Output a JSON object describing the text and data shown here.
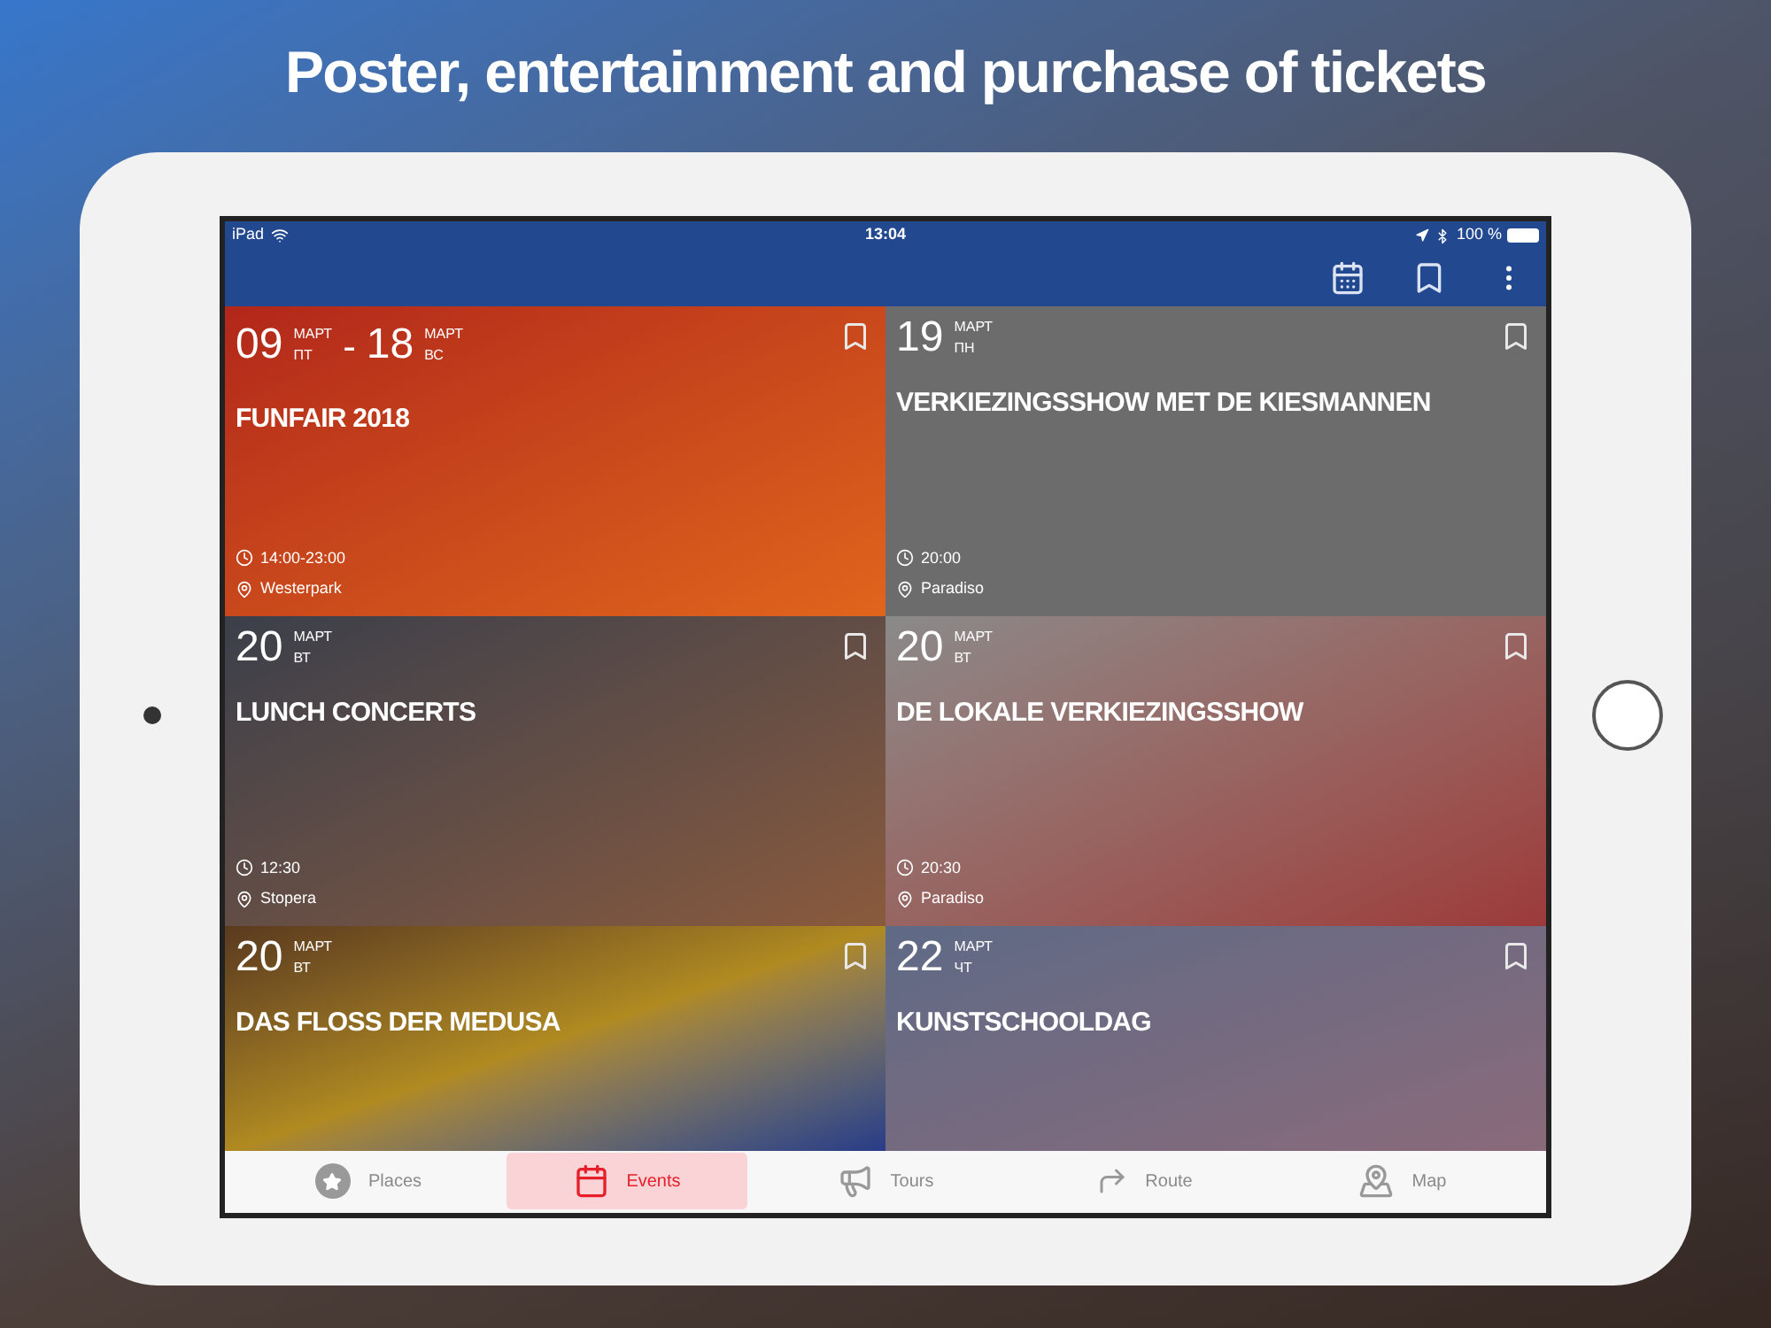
{
  "headline": "Poster, entertainment and purchase of tickets",
  "status_bar": {
    "device": "iPad",
    "time": "13:04",
    "battery": "100 %"
  },
  "events": [
    {
      "dates": [
        {
          "day": "09",
          "month": "МАРТ",
          "weekday": "ПТ"
        },
        {
          "day": "18",
          "month": "МАРТ",
          "weekday": "ВС"
        }
      ],
      "separator": "-",
      "title": "FUNFAIR 2018",
      "time": "14:00-23:00",
      "place": "Westerpark"
    },
    {
      "dates": [
        {
          "day": "19",
          "month": "МАРТ",
          "weekday": "ПН"
        }
      ],
      "title": "VERKIEZINGSSHOW MET DE KIESMANNEN",
      "time": "20:00",
      "place": "Paradiso"
    },
    {
      "dates": [
        {
          "day": "20",
          "month": "МАРТ",
          "weekday": "ВТ"
        }
      ],
      "title": "LUNCH CONCERTS",
      "time": "12:30",
      "place": "Stopera"
    },
    {
      "dates": [
        {
          "day": "20",
          "month": "МАРТ",
          "weekday": "ВТ"
        }
      ],
      "title": "DE LOKALE VERKIEZINGSSHOW",
      "time": "20:30",
      "place": "Paradiso"
    },
    {
      "dates": [
        {
          "day": "20",
          "month": "МАРТ",
          "weekday": "ВТ"
        }
      ],
      "title": "DAS FLOSS DER MEDUSA"
    },
    {
      "dates": [
        {
          "day": "22",
          "month": "МАРТ",
          "weekday": "ЧТ"
        }
      ],
      "title": "KUNSTSCHOOLDAG"
    }
  ],
  "tabs": [
    {
      "kind": "places",
      "label": "Places",
      "selected": false
    },
    {
      "kind": "events",
      "label": "Events",
      "selected": true
    },
    {
      "kind": "tours",
      "label": "Tours",
      "selected": false
    },
    {
      "kind": "route",
      "label": "Route",
      "selected": false
    },
    {
      "kind": "map",
      "label": "Map",
      "selected": false
    }
  ]
}
